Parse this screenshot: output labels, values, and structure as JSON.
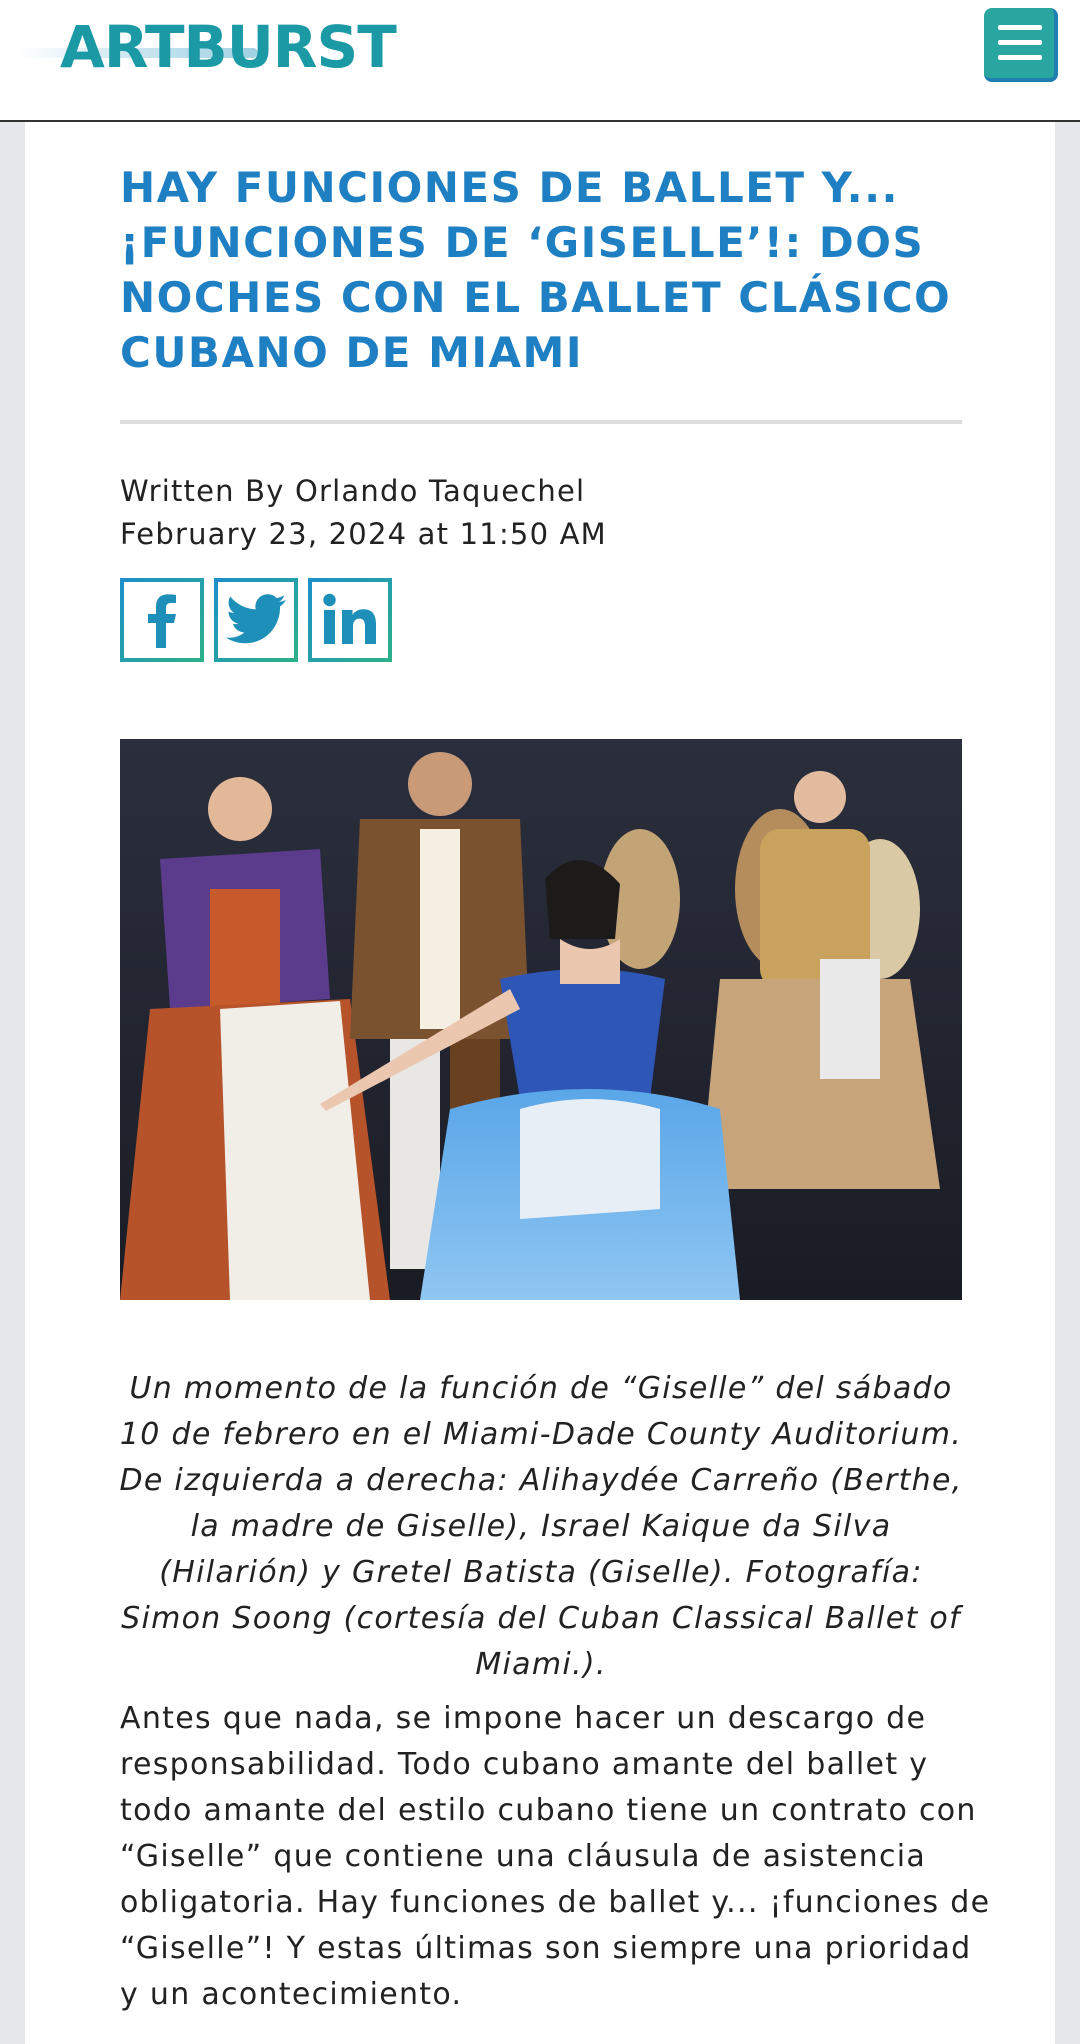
{
  "header": {
    "logo_text": "ARTBURST",
    "menu_icon": "hamburger-menu-icon"
  },
  "article": {
    "title": "HAY FUNCIONES DE BALLET Y... ¡FUNCIONES DE ‘GISELLE’!: DOS NOCHES CON EL BALLET CLÁSICO CUBANO DE MIAMI",
    "byline": "Written By Orlando Taquechel",
    "date": "February 23, 2024 at 11:50 AM",
    "share": [
      {
        "name": "facebook",
        "icon": "facebook-icon"
      },
      {
        "name": "twitter",
        "icon": "twitter-icon"
      },
      {
        "name": "linkedin",
        "icon": "linkedin-icon"
      }
    ],
    "caption": "Un momento de la función de “Giselle” del sábado 10 de febrero en el Miami-Dade County Auditorium. De izquierda a derecha: Alihaydée Carreño (Berthe, la madre de Giselle), Israel Kaique da Silva (Hilarión) y Gretel Batista (Giselle). Fotografía: Simon Soong (cortesía del Cuban Classical Ballet of Miami.).",
    "body_paragraph": "Antes que nada, se impone hacer un descargo de responsabilidad. Todo cubano amante del ballet y todo amante del estilo cubano tiene un contrato con “Giselle” que contiene una cláusula de asistencia obligatoria. Hay funciones de ballet y... ¡funciones de “Giselle”! Y estas últimas son siempre una prioridad y un acontecimiento."
  },
  "colors": {
    "title_blue": "#1e7fc2",
    "brand_teal": "#1b9aa5",
    "menu_green": "#2aa6a0"
  }
}
